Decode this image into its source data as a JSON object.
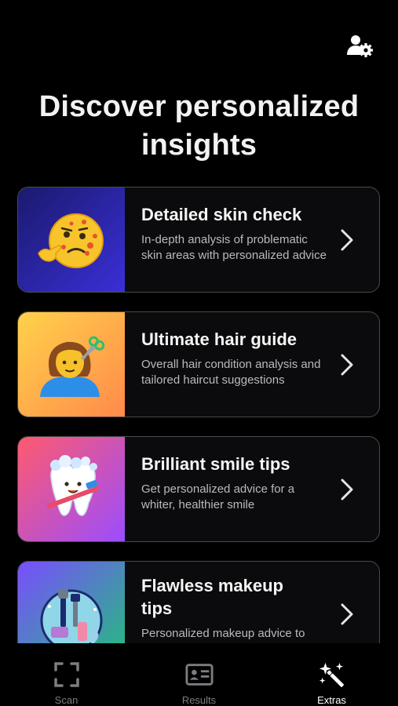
{
  "header": {
    "account_icon": "user-settings-icon",
    "title": "Discover personalized insights"
  },
  "cards": [
    {
      "title": "Detailed skin check",
      "description": "In-depth analysis of problematic skin areas with personalized advice",
      "icon": "acne-face-emoji",
      "gradient": [
        "#1a1a6e",
        "#3a2fd8"
      ]
    },
    {
      "title": "Ultimate hair guide",
      "description": "Overall hair condition analysis and tailored haircut suggestions",
      "icon": "haircut-person-emoji",
      "gradient": [
        "#ffd24a",
        "#ff8a4a"
      ]
    },
    {
      "title": "Brilliant smile tips",
      "description": "Get personalized advice for a whiter, healthier smile",
      "icon": "tooth-brush-emoji",
      "gradient": [
        "#ff5a6e",
        "#9b4dff"
      ]
    },
    {
      "title": "Flawless makeup tips",
      "description": "Personalized makeup advice to",
      "icon": "makeup-brushes-emoji",
      "gradient": [
        "#7a4dff",
        "#22c07a"
      ]
    }
  ],
  "tabbar": {
    "tabs": [
      {
        "label": "Scan",
        "icon": "scan-frame-icon",
        "active": false
      },
      {
        "label": "Results",
        "icon": "id-card-icon",
        "active": false
      },
      {
        "label": "Extras",
        "icon": "magic-wand-icon",
        "active": true
      }
    ]
  },
  "colors": {
    "background": "#000000",
    "card_border": "#4a4a4f",
    "text_secondary": "#b9b9bf",
    "tab_inactive": "#7d7d82"
  }
}
